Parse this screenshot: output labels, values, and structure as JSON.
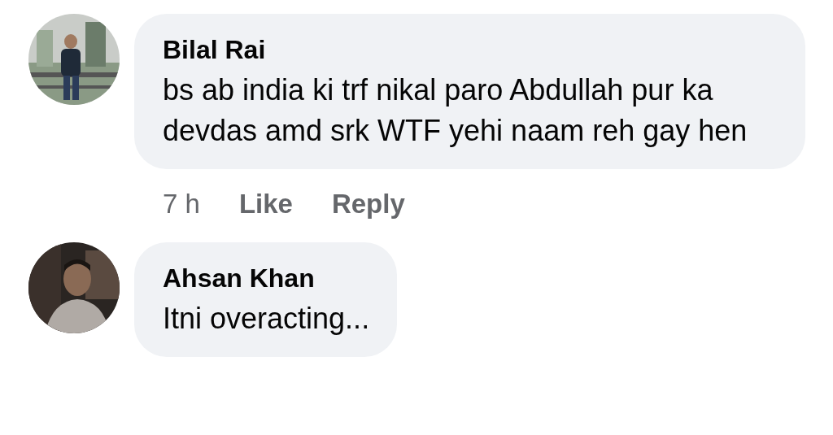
{
  "comments": [
    {
      "author": "Bilal Rai",
      "text": "bs ab india ki trf nikal paro Abdullah pur ka devdas amd srk WTF yehi naam reh gay hen",
      "meta": {
        "time": "7 h",
        "actions": [
          "Like",
          "Reply"
        ]
      }
    },
    {
      "author": "Ahsan Khan",
      "text": "Itni overacting..."
    }
  ]
}
